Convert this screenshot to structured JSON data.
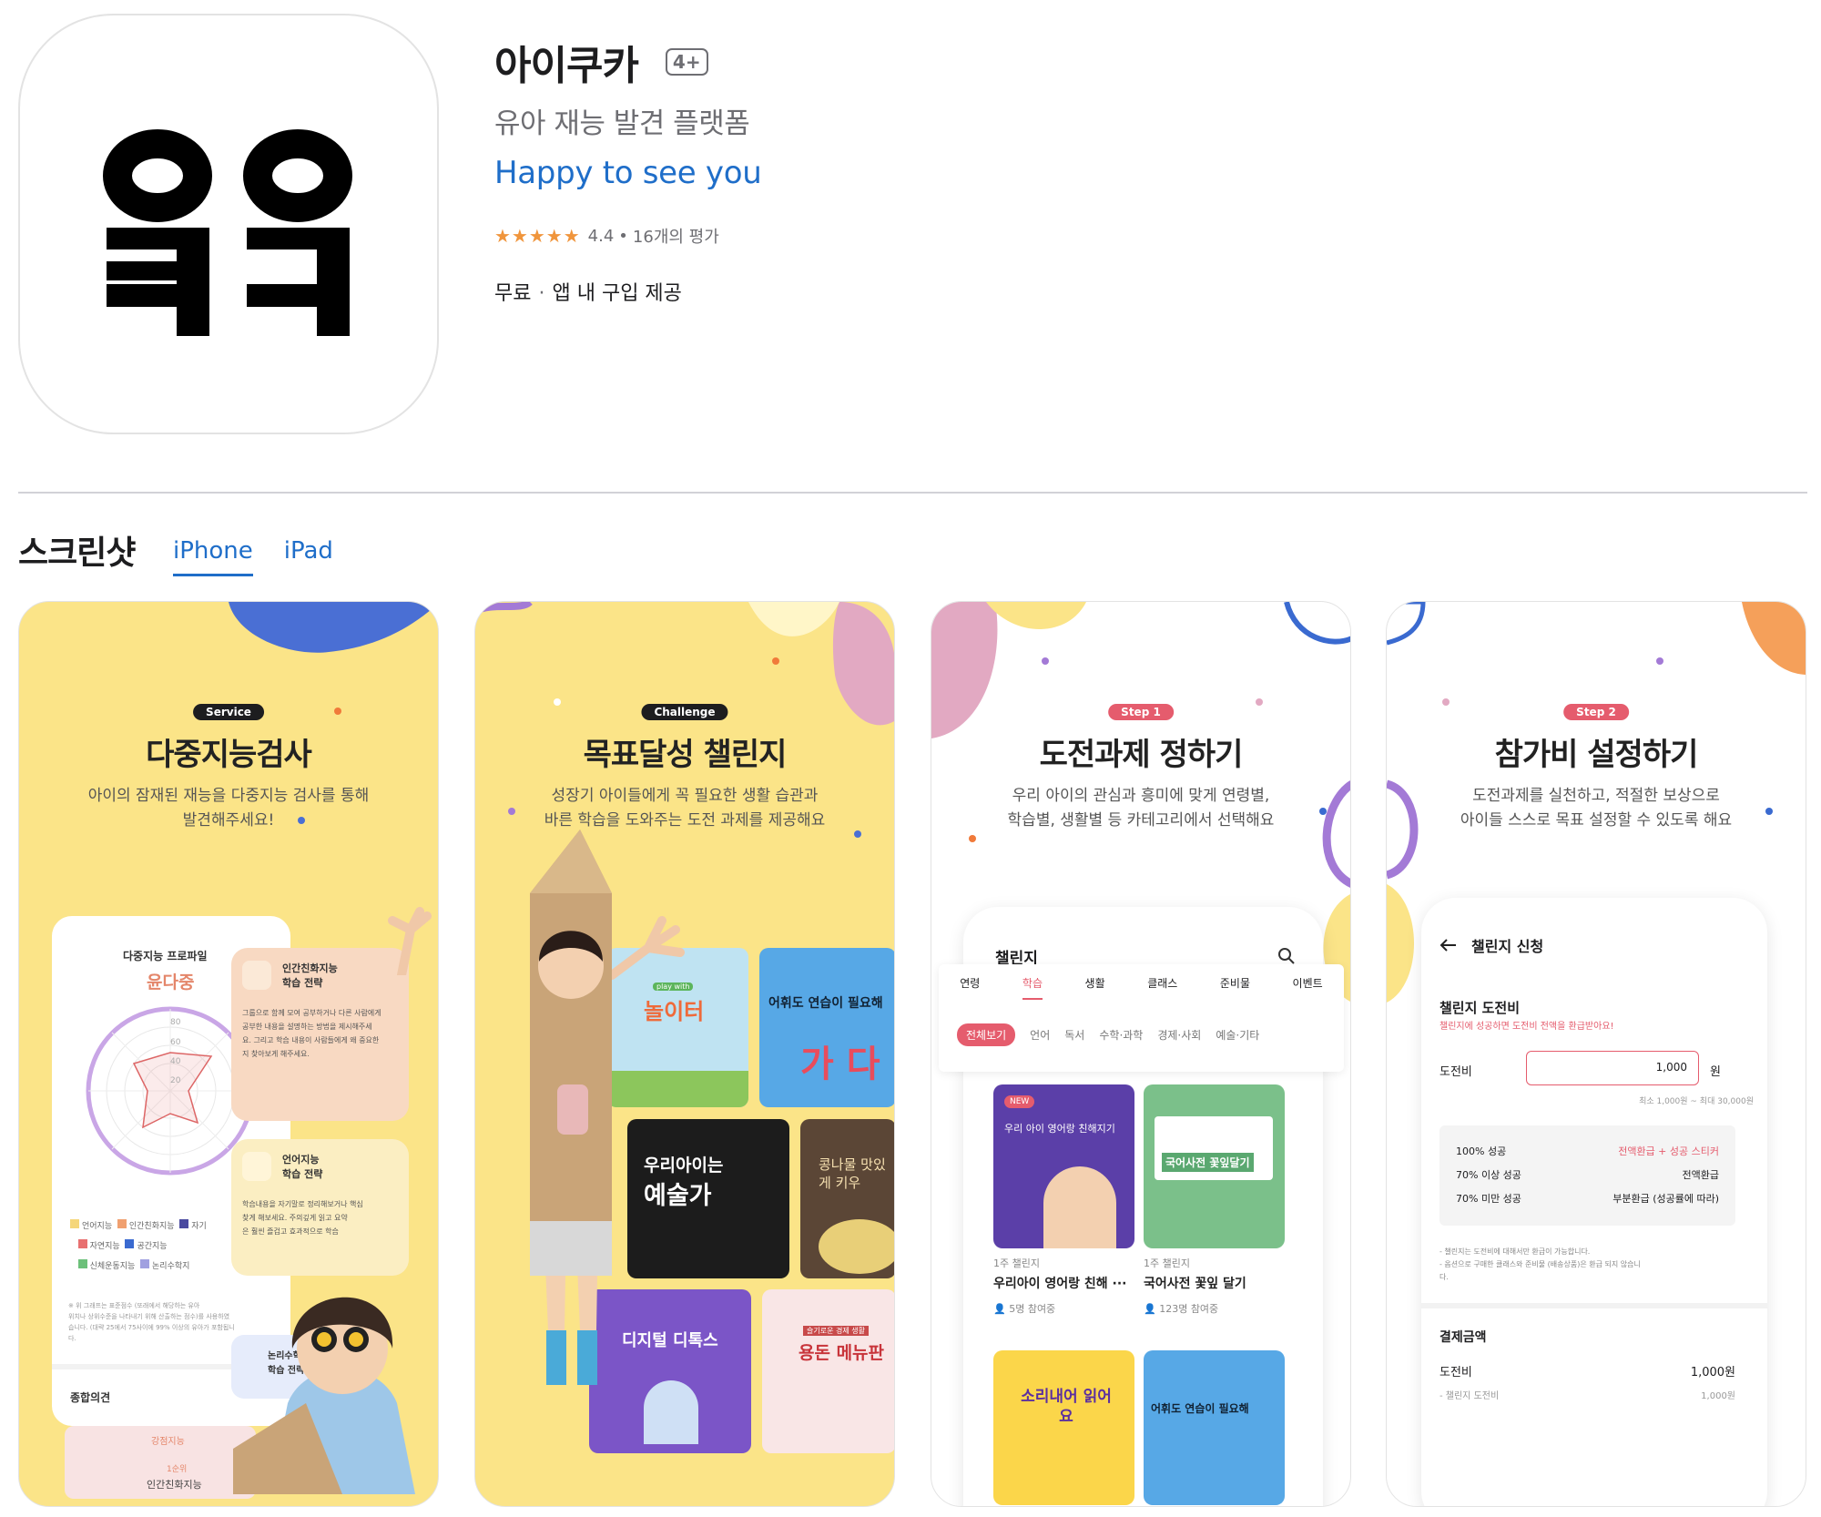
{
  "app": {
    "title": "아이쿠카",
    "age_rating": "4+",
    "subtitle": "유아 재능 발견 플랫폼",
    "developer": "Happy to see you",
    "rating_stars": "★★★★★",
    "rating_value": "4.4",
    "rating_count": "16개의 평가",
    "price": "무료",
    "iap": "앱 내 구입 제공",
    "icon_name": "app-logo-icon"
  },
  "screenshots": {
    "heading": "스크린샷",
    "tabs": [
      "iPhone",
      "iPad"
    ],
    "active_tab": "iPhone",
    "items": [
      {
        "pill": "Service",
        "title": "다중지능검사",
        "desc1": "아이의 잠재된 재능을 다중지능 검사를 통해",
        "desc2": "발견해주세요!",
        "profile_label": "다중지능 프로파일",
        "profile_name": "윤다중",
        "card1_title1": "인간친화지능",
        "card1_title2": "학습 전략",
        "card1_body": [
          "그룹으로 함께 모여 공부하거나 다른 사람에게",
          "공부한 내용을 설명하는 방법을 제시해주세",
          "요. 그리고 학습 내용이 사람들에게 왜 중요한",
          "지 찾아보게 해주세요."
        ],
        "card2_title1": "언어지능",
        "card2_title2": "학습 전략",
        "card2_body": [
          "학습내용을 자기말로 정리해보거나 핵심",
          "찾게 해보세요. 주의깊게 읽고 요약",
          "은 훨씬 즐겁고 효과적으로 학습"
        ],
        "legend": [
          "언어지능",
          "인간친화지능",
          "자기",
          "자연지능",
          "공간지능",
          "신체운동지능",
          "논리수학지"
        ],
        "ticks": [
          "80",
          "60",
          "40",
          "20"
        ],
        "note": [
          "※ 위 그래프는 표준점수 (또래에서 해당하는 유아",
          "위치나 상위수준을 나타내기 위해 산출하는 점수)를 사용하였",
          "습니다. (대략 25에서 75사이에 99% 이상의 유아가 포함됩니",
          "다."
        ],
        "card3_title1": "논리수학지",
        "card3_title2": "학습 전략",
        "summary_label": "종합의견",
        "strength_label": "강점지능",
        "rank_label": "1순위",
        "rank_value": "인간친화지능"
      },
      {
        "pill": "Challenge",
        "title": "목표달성 챌린지",
        "desc1": "성장기 아이들에게 꼭 필요한 생활 습관과",
        "desc2": "바른 학습을 도와주는 도전 과제를 제공해요",
        "tile1_small": "play with",
        "tile1": "놀이터",
        "tile2": "어휘도 연습이 필요해",
        "tile2_big": "가 다",
        "tile3a": "우리아이는",
        "tile3b": "예술가",
        "tile4": "콩나물 맛있게 키우",
        "tile5": "디지털 디톡스",
        "tile6_small": "슬기로운 경제 생활",
        "tile6": "용돈 메뉴판"
      },
      {
        "pill": "Step 1",
        "title": "도전과제 정하기",
        "desc1": "우리 아이의 관심과 흥미에 맞게 연령별,",
        "desc2": "학습별, 생활별 등 카테고리에서 선택해요",
        "screen_title": "챌린지",
        "cats": [
          "연령",
          "학습",
          "생활",
          "클래스",
          "준비물",
          "이벤트"
        ],
        "subcats": [
          "전체보기",
          "언어",
          "독서",
          "수학·과학",
          "경제·사회",
          "예술·기타"
        ],
        "new_badge": "NEW",
        "card1_text": "우리 아이 영어랑 친해지기",
        "card1_meta": "1주 챌린지",
        "card1_title": "우리아이 영어랑 친해 ···",
        "card1_people": "5명 참여중",
        "card2_text": "국어사전 꽃잎달기",
        "card2_meta": "1주 챌린지",
        "card2_title": "국어사전 꽃잎 달기",
        "card2_people": "123명 참여중",
        "card3_text": "소리내어 읽어요",
        "card4_text": "어휘도 연습이 필요해"
      },
      {
        "pill": "Step 2",
        "title": "참가비 설정하기",
        "desc1": "도전과제를 실천하고, 적절한 보상으로",
        "desc2": "아이들 스스로 목표 설정할 수 있도록 해요",
        "back_icon": "arrow-left-icon",
        "screen_title": "챌린지 신청",
        "section": "챌린지 도전비",
        "section_note": "챌린지에 성공하면 도전비 전액을 환급받아요!",
        "fee_label": "도전비",
        "fee_value": "1,000",
        "fee_unit": "원",
        "fee_range": "최소 1,000원 ~ 최대 30,000원",
        "rules": [
          {
            "cond": "100% 성공",
            "reward": "전액환급 + 성공 스티커",
            "accent": true
          },
          {
            "cond": "70% 이상 성공",
            "reward": "전액환급",
            "accent": false
          },
          {
            "cond": "70% 미만 성공",
            "reward": "부분환급 (성공률에 따라)",
            "accent": false
          }
        ],
        "notice1": "- 챌린지는 도전비에 대해서만 환급이 가능합니다.",
        "notice2": "- 옵션으로 구매한 클래스와 준비물 (배송상품)은 환급 되지 않습니",
        "notice3": "다.",
        "pay_title": "결제금액",
        "pay_label": "도전비",
        "pay_value": "1,000원",
        "pay_sub": "- 챌린지 도전비",
        "pay_sub_value": "1,000원"
      }
    ]
  },
  "colors": {
    "link": "#1f6ec9",
    "star": "#f0953c",
    "yellow": "#fbe488",
    "accent_red": "#e55c6d"
  }
}
